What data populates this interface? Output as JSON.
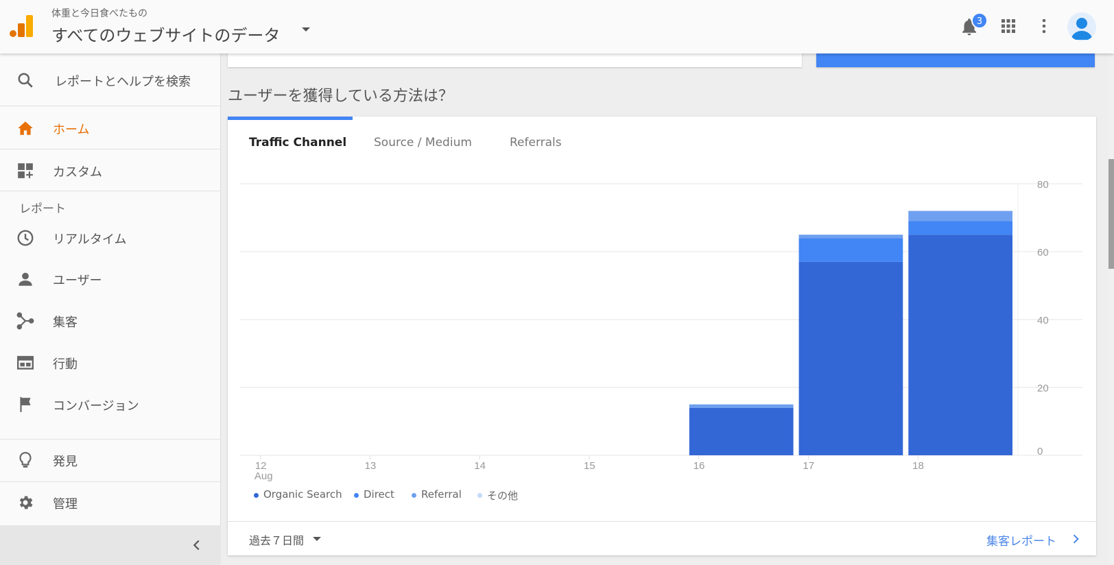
{
  "header": {
    "property_sub": "体重と今日食べたもの",
    "property_title": "すべてのウェブサイトのデータ",
    "notification_count": "3"
  },
  "sidebar": {
    "search_label": "レポートとヘルプを検索",
    "items": [
      {
        "label": "ホーム",
        "icon": "home-icon"
      },
      {
        "label": "カスタム",
        "icon": "dashboard-add-icon"
      },
      {
        "label": "リアルタイム",
        "icon": "clock-icon"
      },
      {
        "label": "ユーザー",
        "icon": "person-icon"
      },
      {
        "label": "集客",
        "icon": "acquisition-icon"
      },
      {
        "label": "行動",
        "icon": "behavior-icon"
      },
      {
        "label": "コンバージョン",
        "icon": "flag-icon"
      },
      {
        "label": "発見",
        "icon": "lightbulb-icon"
      },
      {
        "label": "管理",
        "icon": "gear-icon"
      }
    ],
    "section_label": "レポート"
  },
  "main": {
    "section_title": "ユーザーを獲得している方法は？",
    "tabs": [
      {
        "label": "Traffic Channel"
      },
      {
        "label": "Source / Medium"
      },
      {
        "label": "Referrals"
      }
    ],
    "footer": {
      "range_label": "過去７日間",
      "report_link": "集客レポート"
    }
  },
  "colors": {
    "accent_orange": "#e8710a",
    "accent_blue": "#4285f4",
    "organic": "#3367d6",
    "direct": "#4285f4",
    "referral": "#6fa0f0",
    "other": "#c5d9f8"
  },
  "chart_data": {
    "type": "bar",
    "stacked": true,
    "categories": [
      "12",
      "13",
      "14",
      "15",
      "16",
      "17",
      "18"
    ],
    "category_sublabel": "Aug",
    "ylim": [
      0,
      80
    ],
    "yticks": [
      "0",
      "20",
      "40",
      "60",
      "80"
    ],
    "series": [
      {
        "name": "Organic Search",
        "values": [
          0,
          0,
          0,
          0,
          14,
          57,
          65
        ]
      },
      {
        "name": "Direct",
        "values": [
          0,
          0,
          0,
          0,
          0,
          7,
          4
        ]
      },
      {
        "name": "Referral",
        "values": [
          0,
          0,
          0,
          0,
          1,
          1,
          3
        ]
      },
      {
        "name": "その他",
        "values": [
          0,
          0,
          0,
          0,
          0,
          0,
          0
        ]
      }
    ],
    "legend_position": "bottom-left"
  }
}
